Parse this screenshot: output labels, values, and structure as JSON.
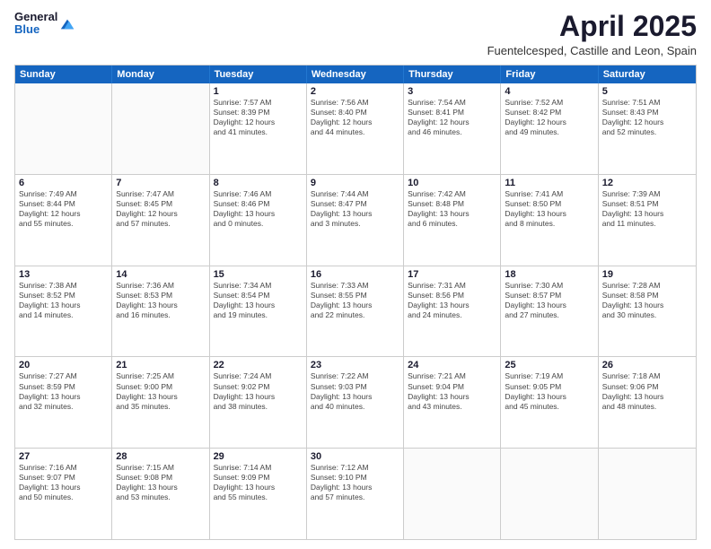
{
  "logo": {
    "general": "General",
    "blue": "Blue"
  },
  "header": {
    "title": "April 2025",
    "subtitle": "Fuentelcesped, Castille and Leon, Spain"
  },
  "days": [
    "Sunday",
    "Monday",
    "Tuesday",
    "Wednesday",
    "Thursday",
    "Friday",
    "Saturday"
  ],
  "rows": [
    [
      {
        "day": "",
        "lines": []
      },
      {
        "day": "",
        "lines": []
      },
      {
        "day": "1",
        "lines": [
          "Sunrise: 7:57 AM",
          "Sunset: 8:39 PM",
          "Daylight: 12 hours",
          "and 41 minutes."
        ]
      },
      {
        "day": "2",
        "lines": [
          "Sunrise: 7:56 AM",
          "Sunset: 8:40 PM",
          "Daylight: 12 hours",
          "and 44 minutes."
        ]
      },
      {
        "day": "3",
        "lines": [
          "Sunrise: 7:54 AM",
          "Sunset: 8:41 PM",
          "Daylight: 12 hours",
          "and 46 minutes."
        ]
      },
      {
        "day": "4",
        "lines": [
          "Sunrise: 7:52 AM",
          "Sunset: 8:42 PM",
          "Daylight: 12 hours",
          "and 49 minutes."
        ]
      },
      {
        "day": "5",
        "lines": [
          "Sunrise: 7:51 AM",
          "Sunset: 8:43 PM",
          "Daylight: 12 hours",
          "and 52 minutes."
        ]
      }
    ],
    [
      {
        "day": "6",
        "lines": [
          "Sunrise: 7:49 AM",
          "Sunset: 8:44 PM",
          "Daylight: 12 hours",
          "and 55 minutes."
        ]
      },
      {
        "day": "7",
        "lines": [
          "Sunrise: 7:47 AM",
          "Sunset: 8:45 PM",
          "Daylight: 12 hours",
          "and 57 minutes."
        ]
      },
      {
        "day": "8",
        "lines": [
          "Sunrise: 7:46 AM",
          "Sunset: 8:46 PM",
          "Daylight: 13 hours",
          "and 0 minutes."
        ]
      },
      {
        "day": "9",
        "lines": [
          "Sunrise: 7:44 AM",
          "Sunset: 8:47 PM",
          "Daylight: 13 hours",
          "and 3 minutes."
        ]
      },
      {
        "day": "10",
        "lines": [
          "Sunrise: 7:42 AM",
          "Sunset: 8:48 PM",
          "Daylight: 13 hours",
          "and 6 minutes."
        ]
      },
      {
        "day": "11",
        "lines": [
          "Sunrise: 7:41 AM",
          "Sunset: 8:50 PM",
          "Daylight: 13 hours",
          "and 8 minutes."
        ]
      },
      {
        "day": "12",
        "lines": [
          "Sunrise: 7:39 AM",
          "Sunset: 8:51 PM",
          "Daylight: 13 hours",
          "and 11 minutes."
        ]
      }
    ],
    [
      {
        "day": "13",
        "lines": [
          "Sunrise: 7:38 AM",
          "Sunset: 8:52 PM",
          "Daylight: 13 hours",
          "and 14 minutes."
        ]
      },
      {
        "day": "14",
        "lines": [
          "Sunrise: 7:36 AM",
          "Sunset: 8:53 PM",
          "Daylight: 13 hours",
          "and 16 minutes."
        ]
      },
      {
        "day": "15",
        "lines": [
          "Sunrise: 7:34 AM",
          "Sunset: 8:54 PM",
          "Daylight: 13 hours",
          "and 19 minutes."
        ]
      },
      {
        "day": "16",
        "lines": [
          "Sunrise: 7:33 AM",
          "Sunset: 8:55 PM",
          "Daylight: 13 hours",
          "and 22 minutes."
        ]
      },
      {
        "day": "17",
        "lines": [
          "Sunrise: 7:31 AM",
          "Sunset: 8:56 PM",
          "Daylight: 13 hours",
          "and 24 minutes."
        ]
      },
      {
        "day": "18",
        "lines": [
          "Sunrise: 7:30 AM",
          "Sunset: 8:57 PM",
          "Daylight: 13 hours",
          "and 27 minutes."
        ]
      },
      {
        "day": "19",
        "lines": [
          "Sunrise: 7:28 AM",
          "Sunset: 8:58 PM",
          "Daylight: 13 hours",
          "and 30 minutes."
        ]
      }
    ],
    [
      {
        "day": "20",
        "lines": [
          "Sunrise: 7:27 AM",
          "Sunset: 8:59 PM",
          "Daylight: 13 hours",
          "and 32 minutes."
        ]
      },
      {
        "day": "21",
        "lines": [
          "Sunrise: 7:25 AM",
          "Sunset: 9:00 PM",
          "Daylight: 13 hours",
          "and 35 minutes."
        ]
      },
      {
        "day": "22",
        "lines": [
          "Sunrise: 7:24 AM",
          "Sunset: 9:02 PM",
          "Daylight: 13 hours",
          "and 38 minutes."
        ]
      },
      {
        "day": "23",
        "lines": [
          "Sunrise: 7:22 AM",
          "Sunset: 9:03 PM",
          "Daylight: 13 hours",
          "and 40 minutes."
        ]
      },
      {
        "day": "24",
        "lines": [
          "Sunrise: 7:21 AM",
          "Sunset: 9:04 PM",
          "Daylight: 13 hours",
          "and 43 minutes."
        ]
      },
      {
        "day": "25",
        "lines": [
          "Sunrise: 7:19 AM",
          "Sunset: 9:05 PM",
          "Daylight: 13 hours",
          "and 45 minutes."
        ]
      },
      {
        "day": "26",
        "lines": [
          "Sunrise: 7:18 AM",
          "Sunset: 9:06 PM",
          "Daylight: 13 hours",
          "and 48 minutes."
        ]
      }
    ],
    [
      {
        "day": "27",
        "lines": [
          "Sunrise: 7:16 AM",
          "Sunset: 9:07 PM",
          "Daylight: 13 hours",
          "and 50 minutes."
        ]
      },
      {
        "day": "28",
        "lines": [
          "Sunrise: 7:15 AM",
          "Sunset: 9:08 PM",
          "Daylight: 13 hours",
          "and 53 minutes."
        ]
      },
      {
        "day": "29",
        "lines": [
          "Sunrise: 7:14 AM",
          "Sunset: 9:09 PM",
          "Daylight: 13 hours",
          "and 55 minutes."
        ]
      },
      {
        "day": "30",
        "lines": [
          "Sunrise: 7:12 AM",
          "Sunset: 9:10 PM",
          "Daylight: 13 hours",
          "and 57 minutes."
        ]
      },
      {
        "day": "",
        "lines": []
      },
      {
        "day": "",
        "lines": []
      },
      {
        "day": "",
        "lines": []
      }
    ]
  ]
}
